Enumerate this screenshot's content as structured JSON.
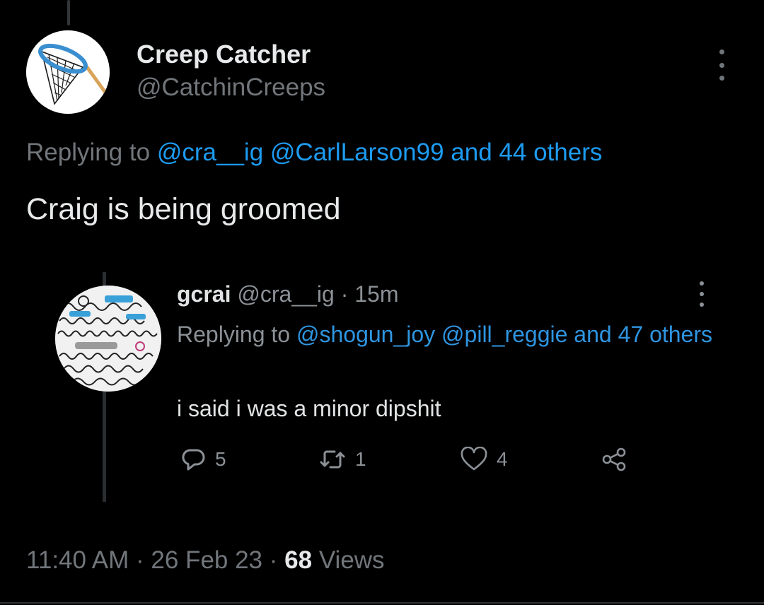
{
  "author": {
    "display_name": "Creep Catcher",
    "handle": "@CatchinCreeps"
  },
  "reply_context": {
    "prefix": "Replying to",
    "mentions": [
      "@cra__ig",
      "@CarlLarson99"
    ],
    "others": "and 44 others"
  },
  "tweet": {
    "text": "Craig is being groomed"
  },
  "embedded_tweet": {
    "display_name": "gcrai",
    "handle": "@cra__ig",
    "separator": "·",
    "time": "15m",
    "reply_prefix": "Replying to",
    "reply_mentions": [
      "@shogun_joy",
      "@pill_reggie"
    ],
    "reply_others": "and 47 others",
    "text": "i said i was a minor dipshit",
    "stats": {
      "replies": "5",
      "retweets": "1",
      "likes": "4"
    }
  },
  "footer": {
    "time": "11:40 AM",
    "separator": "·",
    "date": "26 Feb 23",
    "views_count": "68",
    "views_label": "Views"
  },
  "colors": {
    "background": "#000000",
    "text_primary": "#e7e9ea",
    "text_secondary": "#71767b",
    "link": "#1d9bf0"
  },
  "icons": {
    "more": "more-dots-icon",
    "reply": "reply-bubble-icon",
    "retweet": "retweet-icon",
    "like": "heart-icon",
    "share": "share-icon"
  }
}
